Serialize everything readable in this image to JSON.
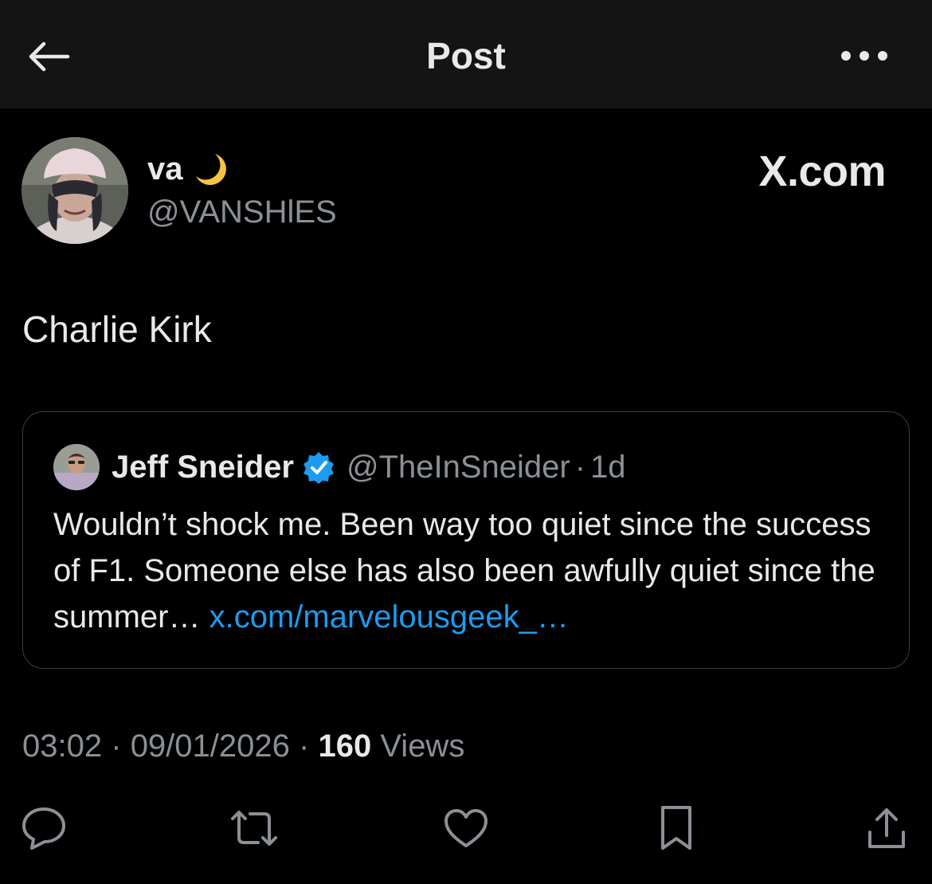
{
  "header": {
    "title": "Post",
    "back_icon": "arrow-left-icon",
    "more_icon": "more-horizontal-icon"
  },
  "author": {
    "display_name": "va",
    "emoji_icon": "crescent-moon-icon",
    "handle": "@VANSHlES",
    "source_label": "X.com"
  },
  "post": {
    "text": "Charlie Kirk"
  },
  "quote": {
    "name": "Jeff Sneider",
    "verified_icon": "verified-badge-icon",
    "handle": "@TheInSneider",
    "separator": "·",
    "time": "1d",
    "text": "Wouldn’t shock me. Been way too quiet since the success of F1. Someone else has also been awfully quiet since the summer…",
    "link": "x.com/marvelousgeek_…"
  },
  "meta": {
    "time": "03:02",
    "separator": "·",
    "date": "09/01/2026",
    "views_count": "160",
    "views_label": "Views"
  },
  "actions": [
    {
      "name": "reply",
      "icon": "reply-icon"
    },
    {
      "name": "repost",
      "icon": "repost-icon"
    },
    {
      "name": "like",
      "icon": "like-icon"
    },
    {
      "name": "bookmark",
      "icon": "bookmark-icon"
    },
    {
      "name": "share",
      "icon": "share-icon"
    }
  ],
  "colors": {
    "background": "#000000",
    "header_background": "#141414",
    "text_primary": "#e7e9ea",
    "text_secondary": "#8b9096",
    "link": "#1d9bf0",
    "verified": "#1d9bf0",
    "border": "#3a3d41"
  }
}
